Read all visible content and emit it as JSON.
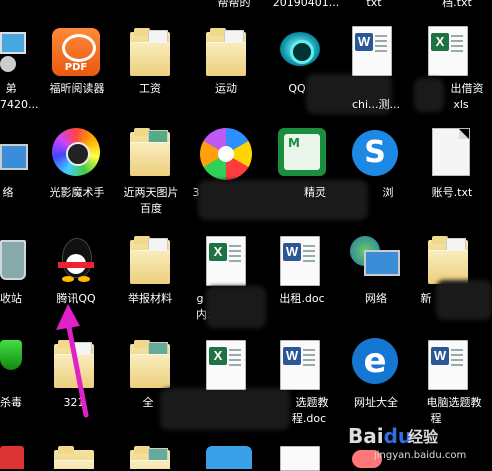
{
  "desktop": {
    "top_row": [
      "帮帮的",
      "20190401...",
      "txt",
      "档.txt"
    ],
    "row1": [
      {
        "label_line1": "弟",
        "label_line2": "7420..."
      },
      {
        "label": "福昕阅读器"
      },
      {
        "label": "工资"
      },
      {
        "label": "运动"
      },
      {
        "label": "QQ"
      },
      {
        "label_line1": "",
        "label_line2": "chi...测..."
      },
      {
        "label_line1": "出借资",
        "label_line2": "xls"
      }
    ],
    "row2": [
      {
        "label": "络"
      },
      {
        "label": "光影魔术手"
      },
      {
        "label_line1": "近两天图片",
        "label_line2": "百度"
      },
      {
        "label": "3"
      },
      {
        "label": "精灵"
      },
      {
        "label": "浏"
      },
      {
        "label": "账号.txt"
      }
    ],
    "row3": [
      {
        "label": "收站"
      },
      {
        "label": "腾讯QQ"
      },
      {
        "label": "举报材料"
      },
      {
        "label_line1": "g",
        "label_line2": "内..."
      },
      {
        "label": "出租.doc"
      },
      {
        "label": "网络"
      },
      {
        "label": "新"
      }
    ],
    "row4": [
      {
        "label": "杀毒"
      },
      {
        "label": "321"
      },
      {
        "label": "全"
      },
      {
        "label": ""
      },
      {
        "label_line1": "选题教",
        "label_line2": "程.doc"
      },
      {
        "label": "网址大全"
      },
      {
        "label_line1": "电脑选题教",
        "label_line2": "程"
      }
    ],
    "icon_texts": {
      "pdf": "PDF",
      "excel": "X",
      "word": "W",
      "m_badge": "M"
    },
    "watermark": {
      "brand": "Bai",
      "brand2": "经验",
      "site": "jingyan.baidu.com"
    },
    "colors": {
      "accent_arrow": "#e020c8",
      "pdf_orange": "#f26b1d",
      "word_blue": "#2b5797",
      "excel_green": "#1f7244"
    }
  }
}
